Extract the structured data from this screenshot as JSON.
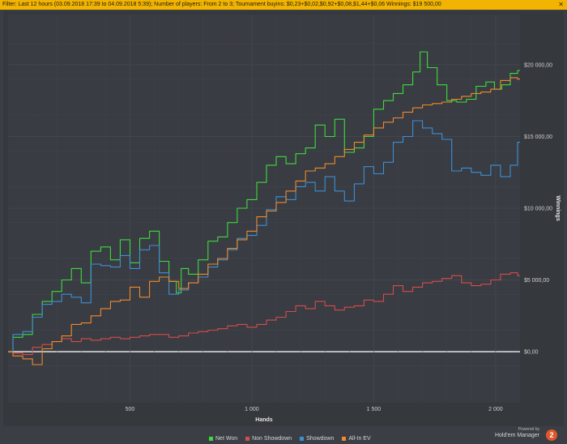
{
  "filter": {
    "text": "Filter: Last 12 hours (03.09.2018 17:39 to 04.09.2018 5:39); Number of players: From 2 to 3; Tournament buyins: $0,23+$0,02,$0,92+$0,08,$1,44+$0,06  Winnings: $19 500,00",
    "close_symbol": "✕"
  },
  "chart_data": {
    "type": "line",
    "xlabel": "Hands",
    "ylabel": "Winnings",
    "xlim": [
      0,
      2100
    ],
    "ylim": [
      -3500,
      23500
    ],
    "x_ticks": [
      500,
      1000,
      1500,
      2000
    ],
    "x_tick_labels": [
      "500",
      "1 000",
      "1 500",
      "2 000"
    ],
    "y_ticks": [
      0,
      5000,
      10000,
      15000,
      20000
    ],
    "y_tick_labels": [
      "$0,00",
      "$5 000,00",
      "$10 000,00",
      "$15 000,00",
      "$20 000,00"
    ],
    "grid": true,
    "legend_position": "bottom",
    "series": [
      {
        "name": "Net Won",
        "color": "#3ddc3d",
        "x": [
          0,
          40,
          80,
          120,
          160,
          200,
          240,
          280,
          320,
          360,
          400,
          440,
          480,
          520,
          560,
          600,
          640,
          680,
          700,
          720,
          760,
          800,
          840,
          880,
          920,
          960,
          1000,
          1040,
          1080,
          1120,
          1160,
          1200,
          1240,
          1280,
          1320,
          1360,
          1400,
          1440,
          1480,
          1520,
          1560,
          1600,
          1640,
          1680,
          1700,
          1740,
          1780,
          1820,
          1860,
          1900,
          1940,
          1980,
          2010,
          2040,
          2080,
          2100
        ],
        "y": [
          0,
          1000,
          1200,
          2600,
          3500,
          4200,
          5000,
          5800,
          4800,
          7000,
          7300,
          6400,
          7800,
          6200,
          7900,
          8400,
          6300,
          4900,
          4100,
          5800,
          5400,
          6400,
          7700,
          8000,
          9000,
          10000,
          10600,
          11800,
          13000,
          13600,
          13100,
          13800,
          14200,
          15800,
          15000,
          16200,
          13900,
          14200,
          15000,
          16900,
          17500,
          18000,
          18600,
          19500,
          20900,
          19800,
          18600,
          17500,
          17400,
          17600,
          18500,
          18800,
          18300,
          18600,
          19400,
          19600
        ]
      },
      {
        "name": "Non Showdown",
        "color": "#d84b4b",
        "x": [
          0,
          40,
          80,
          120,
          160,
          200,
          240,
          280,
          320,
          360,
          400,
          440,
          480,
          520,
          560,
          600,
          640,
          680,
          720,
          760,
          800,
          840,
          880,
          920,
          960,
          1000,
          1040,
          1080,
          1120,
          1160,
          1200,
          1240,
          1280,
          1320,
          1360,
          1400,
          1440,
          1480,
          1520,
          1560,
          1600,
          1640,
          1680,
          1720,
          1760,
          1800,
          1840,
          1880,
          1920,
          1960,
          2000,
          2040,
          2080,
          2100
        ],
        "y": [
          0,
          -100,
          -200,
          300,
          500,
          700,
          900,
          700,
          900,
          800,
          900,
          1000,
          900,
          1000,
          1100,
          1200,
          1200,
          1000,
          1100,
          1300,
          1400,
          1500,
          1600,
          1800,
          1900,
          1700,
          1900,
          2200,
          2400,
          2800,
          3200,
          3000,
          3500,
          3200,
          2900,
          3100,
          3200,
          3600,
          3500,
          4000,
          4600,
          4200,
          4500,
          4800,
          4900,
          5100,
          5300,
          4800,
          4600,
          4700,
          5000,
          5400,
          5500,
          5300
        ]
      },
      {
        "name": "Showdown",
        "color": "#3d8fd6",
        "x": [
          0,
          40,
          80,
          120,
          160,
          200,
          240,
          280,
          320,
          360,
          400,
          440,
          480,
          520,
          560,
          600,
          640,
          680,
          720,
          760,
          800,
          840,
          880,
          920,
          960,
          1000,
          1040,
          1080,
          1120,
          1160,
          1200,
          1240,
          1280,
          1320,
          1360,
          1400,
          1440,
          1480,
          1520,
          1560,
          1600,
          1640,
          1680,
          1720,
          1760,
          1800,
          1840,
          1880,
          1920,
          1960,
          2000,
          2040,
          2080,
          2100
        ],
        "y": [
          0,
          1200,
          1400,
          2400,
          3300,
          3500,
          4000,
          3800,
          3400,
          6100,
          6000,
          5900,
          6700,
          5800,
          7100,
          7400,
          5500,
          4000,
          4300,
          4800,
          5200,
          5900,
          6400,
          7100,
          7900,
          8100,
          8800,
          9900,
          10800,
          10600,
          11500,
          11800,
          11200,
          12200,
          11200,
          10500,
          11700,
          12900,
          12400,
          13200,
          14600,
          15000,
          16100,
          15600,
          15200,
          14800,
          12600,
          12800,
          12500,
          12300,
          13000,
          12200,
          13000,
          14600
        ]
      },
      {
        "name": "All-In EV",
        "color": "#f08a2c",
        "x": [
          0,
          40,
          80,
          120,
          160,
          200,
          240,
          280,
          320,
          360,
          400,
          440,
          480,
          520,
          560,
          600,
          640,
          680,
          720,
          760,
          800,
          840,
          880,
          920,
          960,
          1000,
          1040,
          1080,
          1120,
          1160,
          1200,
          1240,
          1280,
          1320,
          1360,
          1400,
          1440,
          1480,
          1520,
          1560,
          1600,
          1640,
          1680,
          1720,
          1760,
          1800,
          1840,
          1880,
          1920,
          1960,
          2000,
          2040,
          2080,
          2100
        ],
        "y": [
          0,
          -300,
          -500,
          -900,
          200,
          700,
          1100,
          1900,
          2000,
          2500,
          3000,
          3500,
          3600,
          4500,
          3800,
          4900,
          5200,
          4900,
          4400,
          4800,
          5400,
          6100,
          6500,
          7200,
          7800,
          8400,
          9400,
          9800,
          10400,
          11200,
          11900,
          12600,
          12800,
          13100,
          13600,
          14100,
          14600,
          15100,
          15600,
          16000,
          16300,
          16700,
          17000,
          17200,
          17300,
          17400,
          17600,
          17800,
          18000,
          18100,
          18300,
          18900,
          19100,
          19000
        ]
      }
    ]
  },
  "legend_items": [
    {
      "label": "Net Won",
      "color": "#3ddc3d"
    },
    {
      "label": "Non Showdown",
      "color": "#d84b4b"
    },
    {
      "label": "Showdown",
      "color": "#3d8fd6"
    },
    {
      "label": "All-In EV",
      "color": "#f08a2c"
    }
  ],
  "brand": {
    "powered": "Powered by",
    "name": "Hold'em Manager",
    "badge": "2"
  }
}
